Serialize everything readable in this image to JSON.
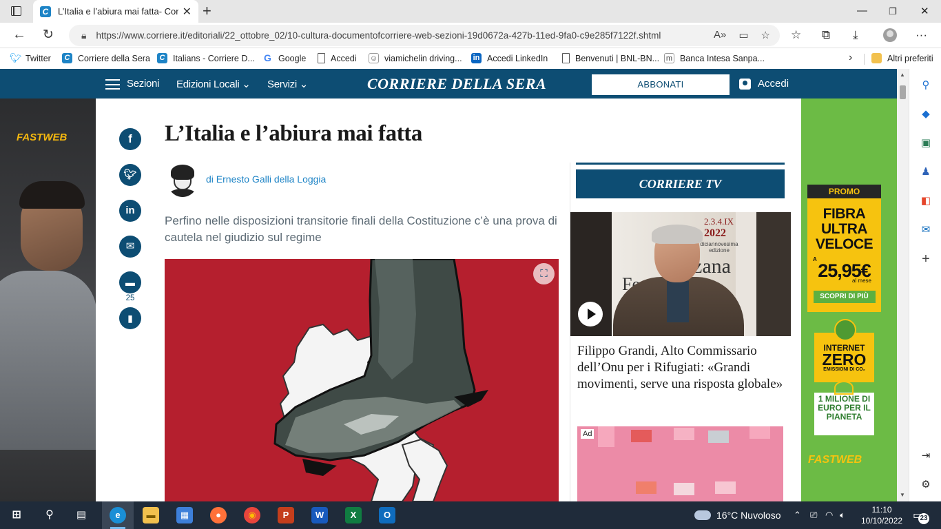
{
  "browser": {
    "tab_title": "L’Italia e l’abiura mai fatta- Corriere.it",
    "url": "https://www.corriere.it/editoriali/22_ottobre_02/10-cultura-documentofcorriere-web-sezioni-19d0672a-427b-11ed-9fa0-c9e285f7122f.shtml",
    "icons": [
      "tab-actions-icon",
      "close-icon",
      "new-tab-icon",
      "minimize-icon",
      "maximize-icon",
      "window-close-icon",
      "back-icon",
      "refresh-icon",
      "lock-icon",
      "read-aloud-icon",
      "reader-view-icon",
      "add-favorite-icon",
      "favorites-icon",
      "collections-icon",
      "downloads-icon",
      "profile-icon",
      "more-icon"
    ]
  },
  "bookmarks": {
    "items": [
      {
        "label": "Twitter",
        "icon": "twitter-icon"
      },
      {
        "label": "Corriere della Sera",
        "icon": "corriere-icon"
      },
      {
        "label": "Italians - Corriere D...",
        "icon": "corriere-icon"
      },
      {
        "label": "Google",
        "icon": "google-icon"
      },
      {
        "label": "Accedi",
        "icon": "page-icon"
      },
      {
        "label": "viamichelin driving...",
        "icon": "michelin-icon"
      },
      {
        "label": "Accedi LinkedIn",
        "icon": "linkedin-icon"
      },
      {
        "label": "Benvenuti | BNL-BN...",
        "icon": "page-icon"
      },
      {
        "label": "Banca Intesa Sanpa...",
        "icon": "bank-icon"
      }
    ],
    "other_favorites": "Altri preferiti"
  },
  "site_nav": {
    "sezioni": "Sezioni",
    "edizioni_locali": "Edizioni Locali",
    "servizi": "Servizi",
    "logo": "CORRIERE DELLA SERA",
    "abbonati": "ABBONATI",
    "accedi": "Accedi"
  },
  "ads": {
    "left_brand": "FASTWEB",
    "promo_header": "PROMO",
    "promo_line1": "FIBRA",
    "promo_line2": "ULTRA",
    "promo_line3": "VELOCE",
    "promo_a": "A",
    "promo_price": "25,95€",
    "promo_period": "al mese",
    "promo_cta": "SCOPRI DI PIÙ",
    "zero_line1": "INTERNET",
    "zero_line2": "ZERO",
    "zero_line3": "EMISSIONI DI CO₂",
    "million_text": "1 MILIONE DI EURO PER IL PIANETA",
    "right_brand": "FASTWEB",
    "ad_label": "Ad"
  },
  "article": {
    "title": "L’Italia e l’abiura mai fatta",
    "author": "di Ernesto Galli della Loggia",
    "subtitle": "Perfino nelle disposizioni transitorie finali della Costituzione c’è una prova di cautela nel giudizio sul regime",
    "comment_count": "25",
    "share_icons": [
      "facebook-icon",
      "twitter-icon",
      "linkedin-icon",
      "email-icon",
      "comment-icon",
      "bookmark-icon"
    ]
  },
  "sidebar": {
    "tv_logo": "CORRIERE TV",
    "video_overlay_1": "2.3.4.IX",
    "video_overlay_2": "2022",
    "video_overlay_3": "diciannovesima edizione",
    "video_overlay_4": "zana",
    "video_overlay_5": "Fes",
    "video_title": "Filippo Grandi, Alto Commissario dell’Onu per i Rifugiati: «Grandi movimenti, serve una risposta globale»"
  },
  "taskbar": {
    "weather": "16°C  Nuvoloso",
    "time": "11:10",
    "date": "10/10/2022",
    "notifications": "23",
    "apps": [
      "start-icon",
      "search-icon",
      "task-view-icon",
      "edge-icon",
      "file-explorer-icon",
      "store-icon",
      "firefox-icon",
      "chrome-icon",
      "powerpoint-icon",
      "word-icon",
      "excel-icon",
      "outlook-icon"
    ]
  }
}
